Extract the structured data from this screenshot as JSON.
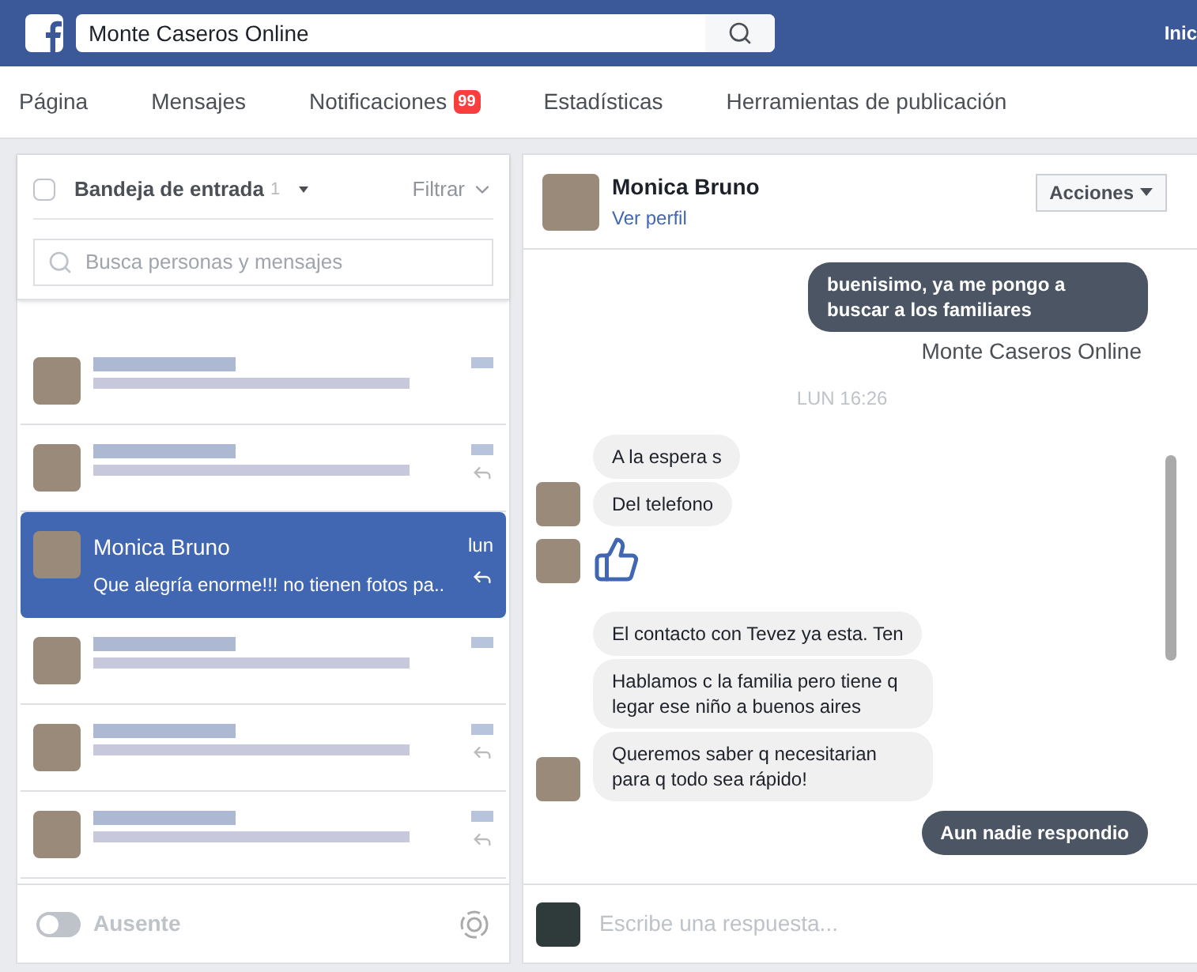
{
  "top_bar": {
    "search_value": "Monte Caseros Online",
    "right_link": "Inic"
  },
  "nav_tabs": [
    {
      "label": "Página"
    },
    {
      "label": "Mensajes"
    },
    {
      "label": "Notificaciones",
      "badge": "99"
    },
    {
      "label": "Estadísticas"
    },
    {
      "label": "Herramientas de publicación"
    }
  ],
  "inbox": {
    "select_all_checked": false,
    "folder": "Bandeja de entrada",
    "count": "1",
    "filter": "Filtrar",
    "search_placeholder": "Busca personas y mensajes",
    "conversations": [
      {
        "kind": "obscured",
        "selected": false,
        "replied": false
      },
      {
        "kind": "obscured",
        "selected": false,
        "replied": true
      },
      {
        "kind": "conversation",
        "selected": true,
        "replied": true,
        "name": "Monica Bruno",
        "preview": "Que alegría enorme!!! no tienen fotos pa..",
        "time": "lun"
      },
      {
        "kind": "obscured",
        "selected": false,
        "replied": false
      },
      {
        "kind": "obscured",
        "selected": false,
        "replied": true
      },
      {
        "kind": "obscured",
        "selected": false,
        "replied": true
      }
    ],
    "away": {
      "label": "Ausente",
      "on": false
    }
  },
  "chat": {
    "name": "Monica Bruno",
    "profile_link": "Ver perfil",
    "actions": "Acciones",
    "reply_placeholder": "Escribe una respuesta...",
    "thread": [
      {
        "kind": "outgoing",
        "text": "buenisimo, ya me pongo a buscar a los familiares"
      },
      {
        "kind": "sender",
        "text": "Monte Caseros Online"
      },
      {
        "kind": "timestamp",
        "text": "LUN 16:26"
      },
      {
        "kind": "incoming",
        "messages": [
          "A la espera s",
          "Del telefono"
        ]
      },
      {
        "kind": "like"
      },
      {
        "kind": "incoming",
        "messages": [
          "El contacto con Tevez ya esta. Ten",
          "Hablamos c la familia pero tiene q legar ese niño a buenos aires",
          "Queremos saber q necesitarian para q todo sea rápido!"
        ]
      },
      {
        "kind": "outgoing",
        "text": "Aun nadie respondio"
      }
    ]
  }
}
